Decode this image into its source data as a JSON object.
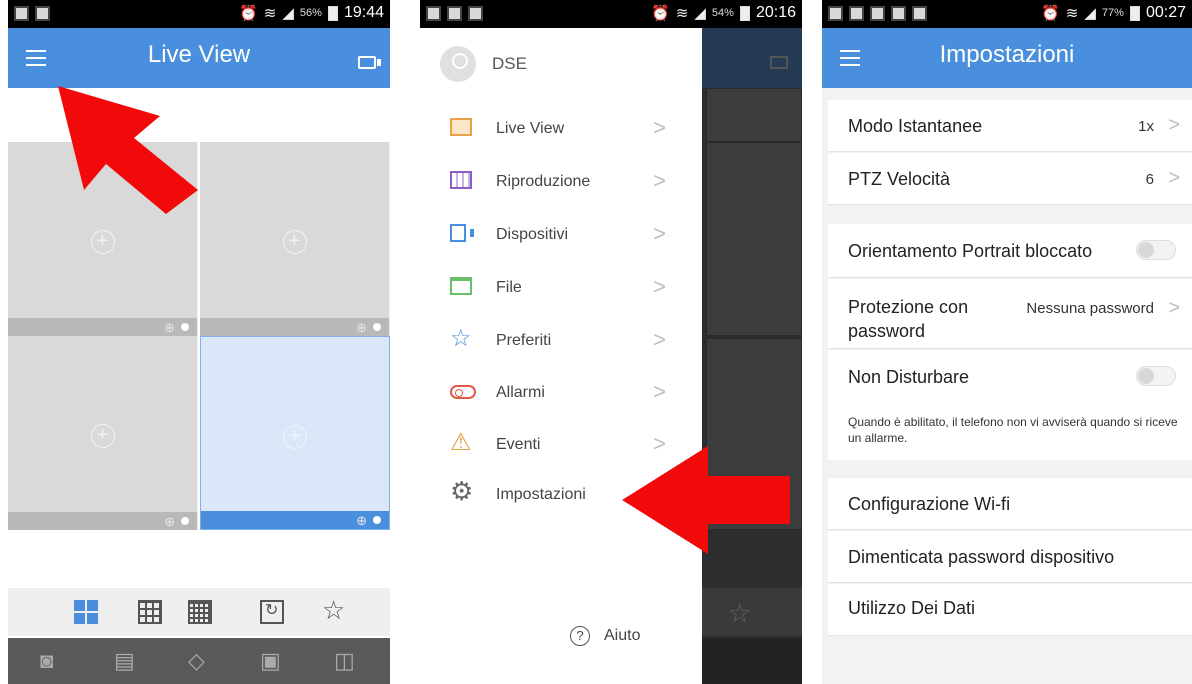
{
  "colors": {
    "accent": "#4a8fde",
    "arrow": "#f20a0a"
  },
  "screen1": {
    "status": {
      "battery": "56%",
      "time": "19:44"
    },
    "title": "Live View",
    "icons": {
      "menu": "menu-icon",
      "record": "camera-icon"
    },
    "layout_options": [
      "1x4-layout-icon",
      "3x3-layout-icon",
      "4x4-layout-icon",
      "sequence-icon",
      "favorites-star-icon"
    ],
    "toolbar": [
      "snapshot-icon",
      "record-clip-icon",
      "ptz-icon",
      "image-icon",
      "audio-icon"
    ]
  },
  "screen2": {
    "status": {
      "battery": "54%",
      "time": "20:16"
    },
    "user": "DSE",
    "menu": [
      {
        "label": "Live View",
        "icon": "live-view-icon"
      },
      {
        "label": "Riproduzione",
        "icon": "playback-film-icon"
      },
      {
        "label": "Dispositivi",
        "icon": "device-camera-icon"
      },
      {
        "label": "File",
        "icon": "folder-icon"
      },
      {
        "label": "Preferiti",
        "icon": "star-icon"
      },
      {
        "label": "Allarmi",
        "icon": "alarm-toggle-icon"
      },
      {
        "label": "Eventi",
        "icon": "warning-icon"
      },
      {
        "label": "Impostazioni",
        "icon": "gear-icon"
      }
    ],
    "help": "Aiuto"
  },
  "screen3": {
    "status": {
      "battery": "77%",
      "time": "00:27"
    },
    "title": "Impostazioni",
    "rows": {
      "snapshot_mode": {
        "label": "Modo Istantanee",
        "value": "1x"
      },
      "ptz_speed": {
        "label": "PTZ Velocità",
        "value": "6"
      },
      "portrait_lock": {
        "label": "Orientamento Portrait bloccato",
        "on": false
      },
      "password": {
        "label_line1": "Protezione con",
        "label_line2": "password",
        "value": "Nessuna password"
      },
      "dnd": {
        "label": "Non Disturbare",
        "on": false,
        "note": "Quando è abilitato, il telefono non vi avviserà quando si riceve un allarme."
      },
      "wifi": {
        "label": "Configurazione Wi-fi"
      },
      "forgot": {
        "label": "Dimenticata password dispositivo"
      },
      "data": {
        "label": "Utilizzo Dei Dati"
      }
    }
  }
}
